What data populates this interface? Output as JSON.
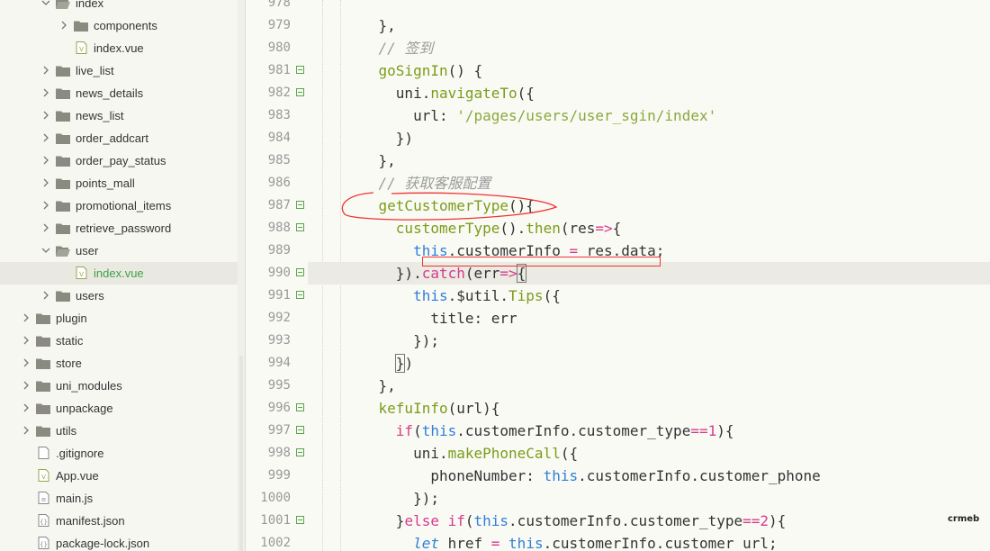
{
  "sidebar": {
    "items": [
      {
        "label": "index",
        "type": "folder",
        "expanded": true,
        "depth": 2
      },
      {
        "label": "components",
        "type": "folder",
        "expanded": false,
        "depth": 3
      },
      {
        "label": "index.vue",
        "type": "vue",
        "depth": 3
      },
      {
        "label": "live_list",
        "type": "folder",
        "expanded": false,
        "depth": 2
      },
      {
        "label": "news_details",
        "type": "folder",
        "expanded": false,
        "depth": 2
      },
      {
        "label": "news_list",
        "type": "folder",
        "expanded": false,
        "depth": 2
      },
      {
        "label": "order_addcart",
        "type": "folder",
        "expanded": false,
        "depth": 2
      },
      {
        "label": "order_pay_status",
        "type": "folder",
        "expanded": false,
        "depth": 2
      },
      {
        "label": "points_mall",
        "type": "folder",
        "expanded": false,
        "depth": 2
      },
      {
        "label": "promotional_items",
        "type": "folder",
        "expanded": false,
        "depth": 2
      },
      {
        "label": "retrieve_password",
        "type": "folder",
        "expanded": false,
        "depth": 2
      },
      {
        "label": "user",
        "type": "folder",
        "expanded": true,
        "depth": 2
      },
      {
        "label": "index.vue",
        "type": "vue",
        "depth": 3,
        "active": true
      },
      {
        "label": "users",
        "type": "folder",
        "expanded": false,
        "depth": 2
      },
      {
        "label": "plugin",
        "type": "folder",
        "expanded": false,
        "depth": 1
      },
      {
        "label": "static",
        "type": "folder",
        "expanded": false,
        "depth": 1
      },
      {
        "label": "store",
        "type": "folder",
        "expanded": false,
        "depth": 1
      },
      {
        "label": "uni_modules",
        "type": "folder",
        "expanded": false,
        "depth": 1
      },
      {
        "label": "unpackage",
        "type": "folder",
        "expanded": false,
        "depth": 1
      },
      {
        "label": "utils",
        "type": "folder",
        "expanded": false,
        "depth": 1
      },
      {
        "label": ".gitignore",
        "type": "file",
        "depth": 1
      },
      {
        "label": "App.vue",
        "type": "vue",
        "depth": 1
      },
      {
        "label": "main.js",
        "type": "js",
        "depth": 1
      },
      {
        "label": "manifest.json",
        "type": "json",
        "depth": 1
      },
      {
        "label": "package-lock.json",
        "type": "json",
        "depth": 1
      }
    ]
  },
  "editor": {
    "current_line": 990,
    "lines": [
      {
        "n": "978",
        "fold": false,
        "tokens": []
      },
      {
        "n": "979",
        "fold": false,
        "tokens": [
          [
            "p",
            "    },"
          ]
        ]
      },
      {
        "n": "980",
        "fold": false,
        "tokens": [
          [
            "c",
            "    // 签到"
          ]
        ]
      },
      {
        "n": "981",
        "fold": true,
        "tokens": [
          [
            "p",
            "    "
          ],
          [
            "f",
            "goSignIn"
          ],
          [
            "p",
            "() {"
          ]
        ]
      },
      {
        "n": "982",
        "fold": true,
        "tokens": [
          [
            "p",
            "      uni."
          ],
          [
            "f",
            "navigateTo"
          ],
          [
            "p",
            "({"
          ]
        ]
      },
      {
        "n": "983",
        "fold": false,
        "tokens": [
          [
            "p",
            "        url: "
          ],
          [
            "s",
            "'/pages/users/user_sgin/index'"
          ]
        ]
      },
      {
        "n": "984",
        "fold": false,
        "tokens": [
          [
            "p",
            "      })"
          ]
        ]
      },
      {
        "n": "985",
        "fold": false,
        "tokens": [
          [
            "p",
            "    },"
          ]
        ]
      },
      {
        "n": "986",
        "fold": false,
        "tokens": [
          [
            "c",
            "    // 获取客服配置"
          ]
        ]
      },
      {
        "n": "987",
        "fold": true,
        "tokens": [
          [
            "p",
            "    "
          ],
          [
            "f",
            "getCustomerType"
          ],
          [
            "p",
            "(){"
          ]
        ]
      },
      {
        "n": "988",
        "fold": true,
        "tokens": [
          [
            "p",
            "      "
          ],
          [
            "f",
            "customerType"
          ],
          [
            "p",
            "()."
          ],
          [
            "f",
            "then"
          ],
          [
            "p",
            "(res"
          ],
          [
            "o",
            "=>"
          ],
          [
            "p",
            "{"
          ]
        ]
      },
      {
        "n": "989",
        "fold": false,
        "tokens": [
          [
            "p",
            "        "
          ],
          [
            "t",
            "this"
          ],
          [
            "p",
            ".customerInfo "
          ],
          [
            "o",
            "="
          ],
          [
            "p",
            " res.data;"
          ]
        ]
      },
      {
        "n": "990",
        "fold": true,
        "tokens": [
          [
            "p",
            "      })."
          ],
          [
            "k",
            "catch"
          ],
          [
            "p",
            "(err"
          ],
          [
            "o",
            "=>"
          ],
          [
            "b",
            "{"
          ]
        ]
      },
      {
        "n": "991",
        "fold": true,
        "tokens": [
          [
            "p",
            "        "
          ],
          [
            "t",
            "this"
          ],
          [
            "p",
            ".$util."
          ],
          [
            "f",
            "Tips"
          ],
          [
            "p",
            "({"
          ]
        ]
      },
      {
        "n": "992",
        "fold": false,
        "tokens": [
          [
            "p",
            "          title: err"
          ]
        ]
      },
      {
        "n": "993",
        "fold": false,
        "tokens": [
          [
            "p",
            "        });"
          ]
        ]
      },
      {
        "n": "994",
        "fold": false,
        "tokens": [
          [
            "p",
            "      "
          ],
          [
            "b",
            "}"
          ],
          [
            "p",
            ")"
          ]
        ]
      },
      {
        "n": "995",
        "fold": false,
        "tokens": [
          [
            "p",
            "    },"
          ]
        ]
      },
      {
        "n": "996",
        "fold": true,
        "tokens": [
          [
            "p",
            "    "
          ],
          [
            "f",
            "kefuInfo"
          ],
          [
            "p",
            "(url){"
          ]
        ]
      },
      {
        "n": "997",
        "fold": true,
        "tokens": [
          [
            "p",
            "      "
          ],
          [
            "k",
            "if"
          ],
          [
            "p",
            "("
          ],
          [
            "t",
            "this"
          ],
          [
            "p",
            ".customerInfo.customer_type"
          ],
          [
            "o",
            "=="
          ],
          [
            "n",
            "1"
          ],
          [
            "p",
            "){"
          ]
        ]
      },
      {
        "n": "998",
        "fold": true,
        "tokens": [
          [
            "p",
            "        uni."
          ],
          [
            "f",
            "makePhoneCall"
          ],
          [
            "p",
            "({"
          ]
        ]
      },
      {
        "n": "999",
        "fold": false,
        "tokens": [
          [
            "p",
            "          phoneNumber: "
          ],
          [
            "t",
            "this"
          ],
          [
            "p",
            ".customerInfo.customer_phone"
          ]
        ]
      },
      {
        "n": "1000",
        "fold": false,
        "tokens": [
          [
            "p",
            "        });"
          ]
        ]
      },
      {
        "n": "1001",
        "fold": true,
        "tokens": [
          [
            "p",
            "      }"
          ],
          [
            "k",
            "else if"
          ],
          [
            "p",
            "("
          ],
          [
            "t",
            "this"
          ],
          [
            "p",
            ".customerInfo.customer_type"
          ],
          [
            "o",
            "=="
          ],
          [
            "n",
            "2"
          ],
          [
            "p",
            "){"
          ]
        ]
      },
      {
        "n": "1002",
        "fold": false,
        "tokens": [
          [
            "p",
            "        "
          ],
          [
            "l",
            "let"
          ],
          [
            "p",
            " href "
          ],
          [
            "o",
            "="
          ],
          [
            "p",
            " "
          ],
          [
            "t",
            "this"
          ],
          [
            "p",
            ".customerInfo.customer_url;"
          ]
        ]
      }
    ]
  },
  "watermark": "crmeb",
  "colors": {
    "accent": "#3fa23f",
    "annotation": "#e33333"
  }
}
